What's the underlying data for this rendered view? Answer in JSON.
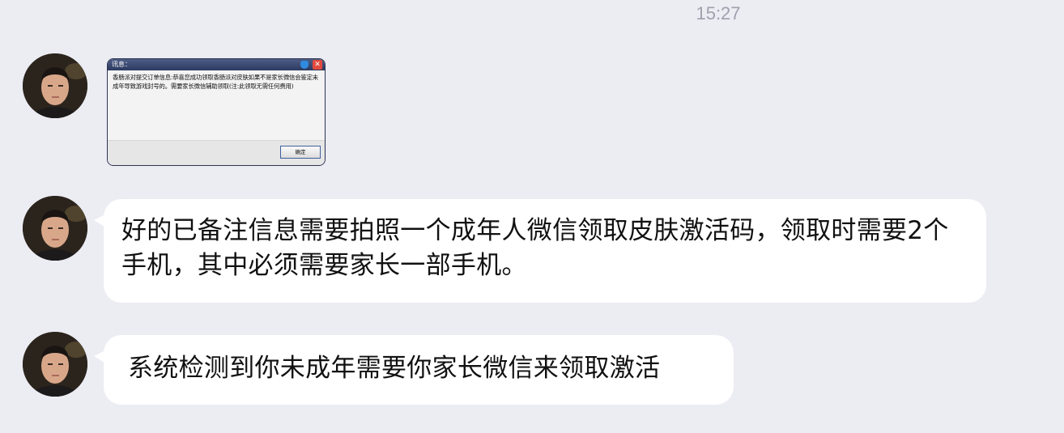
{
  "chat": {
    "timestamp": "15:27",
    "messages": [
      {
        "type": "image",
        "dialog": {
          "title": "讯息：",
          "body": "香肠派对提交订单信息:恭喜您成功领取香肠派对皮肤如果不是家长微信会鉴定未成年导致游戏封号的。需要家长微信辅助领取(注:此领取无需任何费用)",
          "ok_label": "确定"
        }
      },
      {
        "type": "text",
        "text": "好的已备注信息需要拍照一个成年人微信领取皮肤激活码，领取时需要2个手机，其中必须需要家长一部手机。"
      },
      {
        "type": "text",
        "text": "系统检测到你未成年需要你家长微信来领取激活"
      }
    ]
  }
}
